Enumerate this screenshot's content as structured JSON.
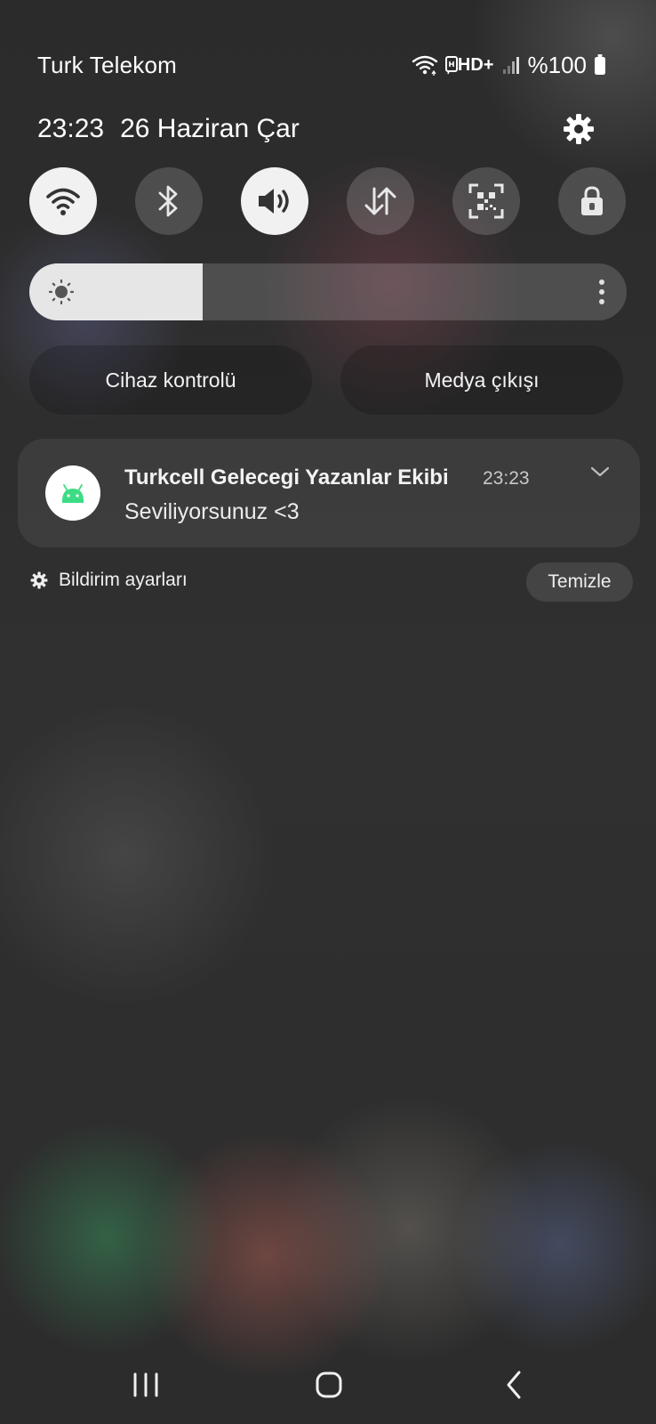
{
  "status_bar": {
    "carrier": "Turk Telekom",
    "network_label": "HD+",
    "battery": "%100",
    "icons": [
      "wifi-icon",
      "volte-hd-icon",
      "signal-icon",
      "battery-icon"
    ]
  },
  "header": {
    "time": "23:23",
    "date": "26 Haziran Çar"
  },
  "quick_settings": [
    {
      "name": "wifi",
      "icon": "wifi-icon",
      "state": "on"
    },
    {
      "name": "bluetooth",
      "icon": "bluetooth-icon",
      "state": "off"
    },
    {
      "name": "sound",
      "icon": "sound-icon",
      "state": "on"
    },
    {
      "name": "mobile-data",
      "icon": "data-arrows-icon",
      "state": "off"
    },
    {
      "name": "qr-scanner",
      "icon": "qr-scan-icon",
      "state": "off"
    },
    {
      "name": "lock",
      "icon": "lock-icon",
      "state": "off"
    }
  ],
  "brightness": {
    "level": 0.29
  },
  "buttons": {
    "device_control": "Cihaz kontrolü",
    "media_output": "Medya çıkışı"
  },
  "notification": {
    "app_icon": "android-icon",
    "title": "Turkcell Gelecegi Yazanlar Ekibi",
    "time": "23:23",
    "body": "Seviliyorsunuz <3"
  },
  "footer": {
    "settings_label": "Bildirim ayarları",
    "clear_label": "Temizle"
  },
  "colors": {
    "accent_android": "#3ddc84",
    "toggle_on": "#f1f1f1"
  }
}
